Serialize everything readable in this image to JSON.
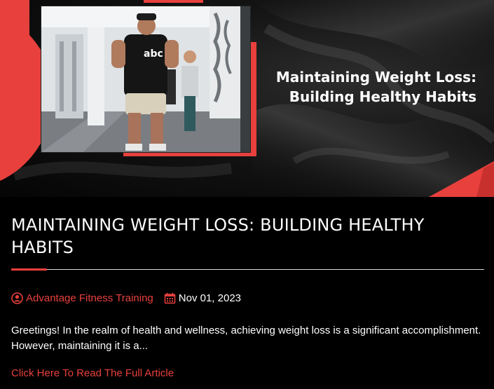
{
  "hero": {
    "title_line1": "Maintaining Weight Loss:",
    "title_line2": "Building Healthy Habits",
    "shirt_logo_text": "abc"
  },
  "article": {
    "title": "MAINTAINING WEIGHT LOSS: BUILDING HEALTHY HABITS",
    "author": "Advantage Fitness Training",
    "date": "Nov 01, 2023",
    "excerpt": "Greetings! In the realm of health and wellness, achieving weight loss is a significant accomplishment. However, maintaining it is a...",
    "read_more": "Click Here To Read The Full Article"
  },
  "icons": {
    "author": "user-circle-icon",
    "date": "calendar-icon"
  },
  "colors": {
    "accent": "#e8403d",
    "background": "#000000",
    "text": "#ffffff"
  }
}
